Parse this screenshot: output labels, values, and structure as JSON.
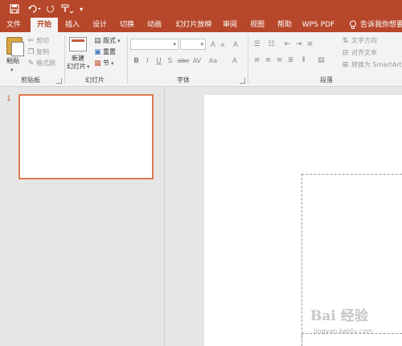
{
  "colors": {
    "accent": "#b7472a",
    "ribbon_bg": "#f3f3f3",
    "workspace_bg": "#e6e6e6",
    "thumb_border": "#e07a52"
  },
  "quick_access": {
    "save_icon": "save-icon",
    "undo_icon": "undo-icon",
    "redo_icon": "redo-icon",
    "format_brush_icon": "format-painter-icon",
    "customize_icon": "dropdown-icon"
  },
  "tabs": [
    {
      "label": "文件",
      "active": false
    },
    {
      "label": "开始",
      "active": true
    },
    {
      "label": "插入",
      "active": false
    },
    {
      "label": "设计",
      "active": false
    },
    {
      "label": "切换",
      "active": false
    },
    {
      "label": "动画",
      "active": false
    },
    {
      "label": "幻灯片放映",
      "active": false
    },
    {
      "label": "审阅",
      "active": false
    },
    {
      "label": "视图",
      "active": false
    },
    {
      "label": "帮助",
      "active": false
    },
    {
      "label": "WPS PDF",
      "active": false
    }
  ],
  "tell_me": {
    "text": "告诉我你想要做"
  },
  "ribbon": {
    "clipboard": {
      "paste": "粘贴",
      "cut": "剪切",
      "copy": "复制",
      "format_painter": "格式刷",
      "group_label": "剪贴板"
    },
    "slides": {
      "new_slide_line1": "新建",
      "new_slide_line2": "幻灯片",
      "layout": "版式",
      "reset": "重置",
      "section": "节",
      "group_label": "幻灯片"
    },
    "font": {
      "font_name_value": "",
      "font_size_value": "",
      "group_label": "字体",
      "bold": "B",
      "italic": "I",
      "underline": "U",
      "shadow": "S",
      "strike": "abc",
      "spacing": "AV",
      "case": "Aa",
      "grow": "A",
      "shrink": "A",
      "clear": "A",
      "color": "A"
    },
    "paragraph": {
      "text_direction": "文字方向",
      "align_text": "对齐文本",
      "smartart": "转换为 SmartArt",
      "group_label": "段落"
    }
  },
  "thumbnails": [
    {
      "number": "1"
    }
  ],
  "watermark": {
    "logo": "Bai 经验",
    "url": "jingyan.baidu.com"
  }
}
